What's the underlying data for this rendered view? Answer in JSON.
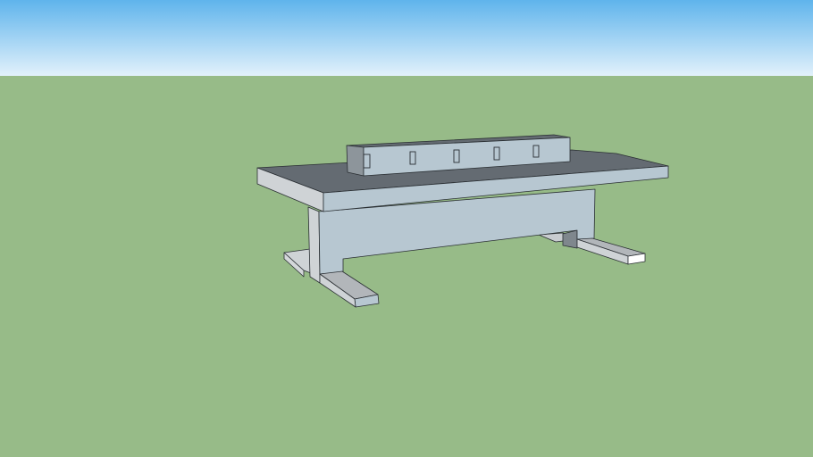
{
  "scene": {
    "sky_top_color": "#5fb4ec",
    "sky_bottom_color": "#dff0fb",
    "ground_color": "#97bb88",
    "model_face_color": "#b7c7d1",
    "model_side_color": "#cfd3d6",
    "model_top_color": "#646b72"
  }
}
